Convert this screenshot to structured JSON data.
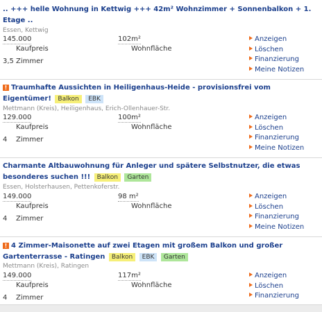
{
  "listings": [
    {
      "title": ".. +++ helle Wohnung in Kettwig +++ 42m² Wohnzimmer + Sonnenbalkon + 1. Etage ..",
      "has_exclamation": false,
      "tags": [],
      "location": "Essen, Kettwig",
      "price": "145.000",
      "price_label": "Kaufpreis",
      "area": "102m²",
      "area_label": "Wohnfläche",
      "rooms": "3,5",
      "rooms_label": "Zimmer",
      "actions": [
        "Anzeigen",
        "Löschen",
        "Finanzierung",
        "Meine Notizen"
      ]
    },
    {
      "title": "Traumhafte Aussichten in Heiligenhaus-Heide - provisionsfrei vom Eigentümer!",
      "has_exclamation": true,
      "tags": [
        {
          "label": "Balkon",
          "color": "#f6ef78"
        },
        {
          "label": "EBK",
          "color": "#cde3f8"
        }
      ],
      "location": "Mettmann (Kreis), Heiligenhaus, Erich-Ollenhauer-Str.",
      "price": "129.000",
      "price_label": "Kaufpreis",
      "area": "100m²",
      "area_label": "Wohnfläche",
      "rooms": "4",
      "rooms_label": "Zimmer",
      "actions": [
        "Anzeigen",
        "Löschen",
        "Finanzierung",
        "Meine Notizen"
      ]
    },
    {
      "title": "Charmante Altbauwohnung für Anleger und spätere Selbstnutzer, die etwas besonderes suchen !!!",
      "has_exclamation": false,
      "tags": [
        {
          "label": "Balkon",
          "color": "#f6ef78"
        },
        {
          "label": "Garten",
          "color": "#aee69a"
        }
      ],
      "location": "Essen, Holsterhausen, Pettenkoferstr.",
      "price": "149.000",
      "price_label": "Kaufpreis",
      "area": "98  m²",
      "area_label": "Wohnfläche",
      "rooms": "4",
      "rooms_label": "Zimmer",
      "actions": [
        "Anzeigen",
        "Löschen",
        "Finanzierung",
        "Meine Notizen"
      ]
    },
    {
      "title": "4 Zimmer-Maisonette auf zwei Etagen mit großem Balkon und großer Gartenterrasse - Ratingen",
      "has_exclamation": true,
      "tags": [
        {
          "label": "Balkon",
          "color": "#f6ef78"
        },
        {
          "label": "EBK",
          "color": "#cde3f8"
        },
        {
          "label": "Garten",
          "color": "#aee69a"
        }
      ],
      "location": "Mettmann (Kreis), Ratingen",
      "price": "149.000",
      "price_label": "Kaufpreis",
      "area": "117m²",
      "area_label": "Wohnfläche",
      "rooms": "4",
      "rooms_label": "Zimmer",
      "actions": [
        "Anzeigen",
        "Löschen",
        "Finanzierung"
      ]
    }
  ],
  "colors": {
    "title": "#1a3e8c",
    "link": "#1a3e8c",
    "arrow": "#ee6a1a",
    "location": "#8a8a8a"
  }
}
